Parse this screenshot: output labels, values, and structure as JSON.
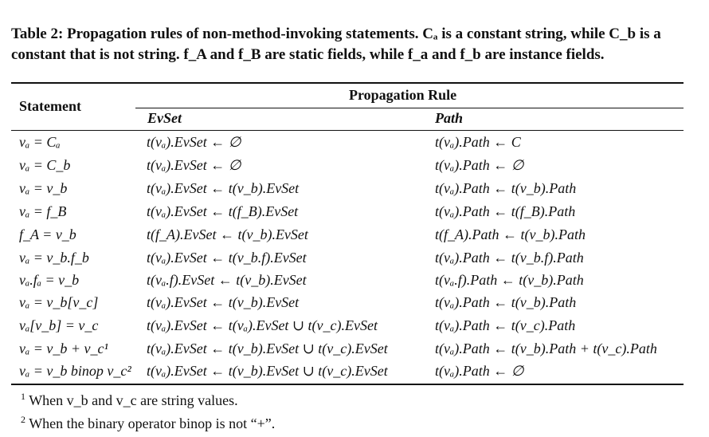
{
  "caption": {
    "label": "Table 2:",
    "text": "Propagation rules of non-method-invoking statements. Cₐ is a constant string, while C_b is a constant that is not string. f_A and f_B are static fields, while f_a and f_b are instance fields."
  },
  "header": {
    "statement": "Statement",
    "propagation_rule": "Propagation Rule",
    "evset": "EvSet",
    "path": "Path"
  },
  "rows": [
    {
      "statement": "vₐ = Cₐ",
      "evset": "t(vₐ).EvSet ← ∅",
      "path": "t(vₐ).Path ← C"
    },
    {
      "statement": "vₐ = C_b",
      "evset": "t(vₐ).EvSet ← ∅",
      "path": "t(vₐ).Path ← ∅"
    },
    {
      "statement": "vₐ = v_b",
      "evset": "t(vₐ).EvSet ← t(v_b).EvSet",
      "path": "t(vₐ).Path ← t(v_b).Path"
    },
    {
      "statement": "vₐ = f_B",
      "evset": "t(vₐ).EvSet ← t(f_B).EvSet",
      "path": "t(vₐ).Path ← t(f_B).Path"
    },
    {
      "statement": "f_A = v_b",
      "evset": "t(f_A).EvSet ← t(v_b).EvSet",
      "path": "t(f_A).Path ← t(v_b).Path"
    },
    {
      "statement": "vₐ = v_b.f_b",
      "evset": "t(vₐ).EvSet ← t(v_b.f).EvSet",
      "path": "t(vₐ).Path ← t(v_b.f).Path"
    },
    {
      "statement": "vₐ.fₐ = v_b",
      "evset": "t(vₐ.f).EvSet ← t(v_b).EvSet",
      "path": "t(vₐ.f).Path ← t(v_b).Path"
    },
    {
      "statement": "vₐ = v_b[v_c]",
      "evset": "t(vₐ).EvSet ← t(v_b).EvSet",
      "path": "t(vₐ).Path ← t(v_b).Path"
    },
    {
      "statement": "vₐ[v_b] = v_c",
      "evset": "t(vₐ).EvSet ← t(vₐ).EvSet ∪ t(v_c).EvSet",
      "path": "t(vₐ).Path ← t(v_c).Path"
    },
    {
      "statement": "vₐ = v_b + v_c¹",
      "evset": "t(vₐ).EvSet ← t(v_b).EvSet ∪ t(v_c).EvSet",
      "path": "t(vₐ).Path ← t(v_b).Path + t(v_c).Path"
    },
    {
      "statement": "vₐ = v_b binop v_c²",
      "evset": "t(vₐ).EvSet ← t(v_b).EvSet ∪ t(v_c).EvSet",
      "path": "t(vₐ).Path ← ∅"
    }
  ],
  "footnotes": [
    {
      "mark": "1",
      "text": "When v_b and v_c are string values."
    },
    {
      "mark": "2",
      "text": "When the binary operator binop is not “+”."
    }
  ]
}
